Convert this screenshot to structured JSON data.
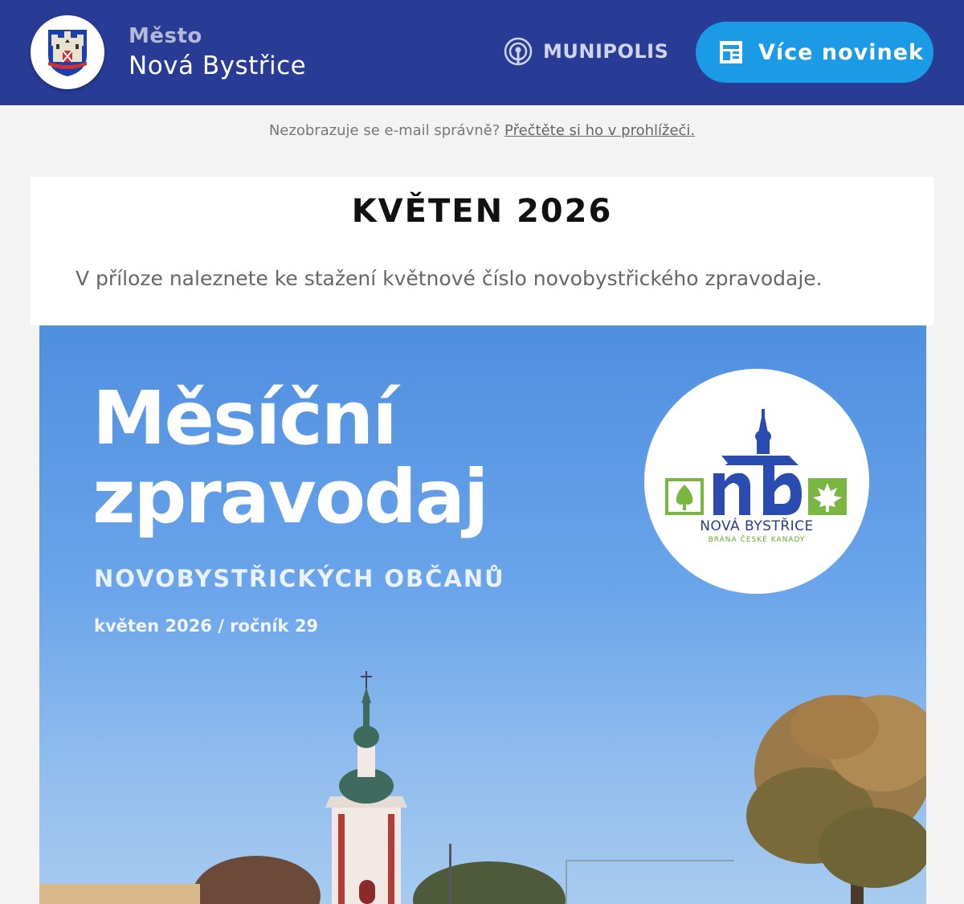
{
  "header": {
    "city_label": "Město",
    "city_name": "Nová Bystřice",
    "brand": "MUNIPOLIS",
    "more_news_label": "Více novinek",
    "crest_icon": "city-crest-icon",
    "brand_icon": "broadcast-icon",
    "more_news_icon": "newspaper-icon",
    "colors": {
      "header_bg": "#283c96",
      "button_bg": "#1b9ae6"
    }
  },
  "browser_note": {
    "text": "Nezobrazuje se e-mail správně?",
    "link": "Přečtěte si ho v prohlížeči."
  },
  "article": {
    "title": "KVĚTEN 2026",
    "body": "V příloze naleznete ke stažení květnové číslo novobystřického zpravodaje."
  },
  "cover": {
    "title_line1": "Měsíční",
    "title_line2": "zpravodaj",
    "subtitle": "NOVOBYSTŘICKÝCH OBČANŮ",
    "issue": "květen 2026 / ročník 29",
    "logo_name": "NOVÁ BYSTŘICE",
    "logo_tagline": "BRÁNA ČESKÉ KANADY"
  }
}
